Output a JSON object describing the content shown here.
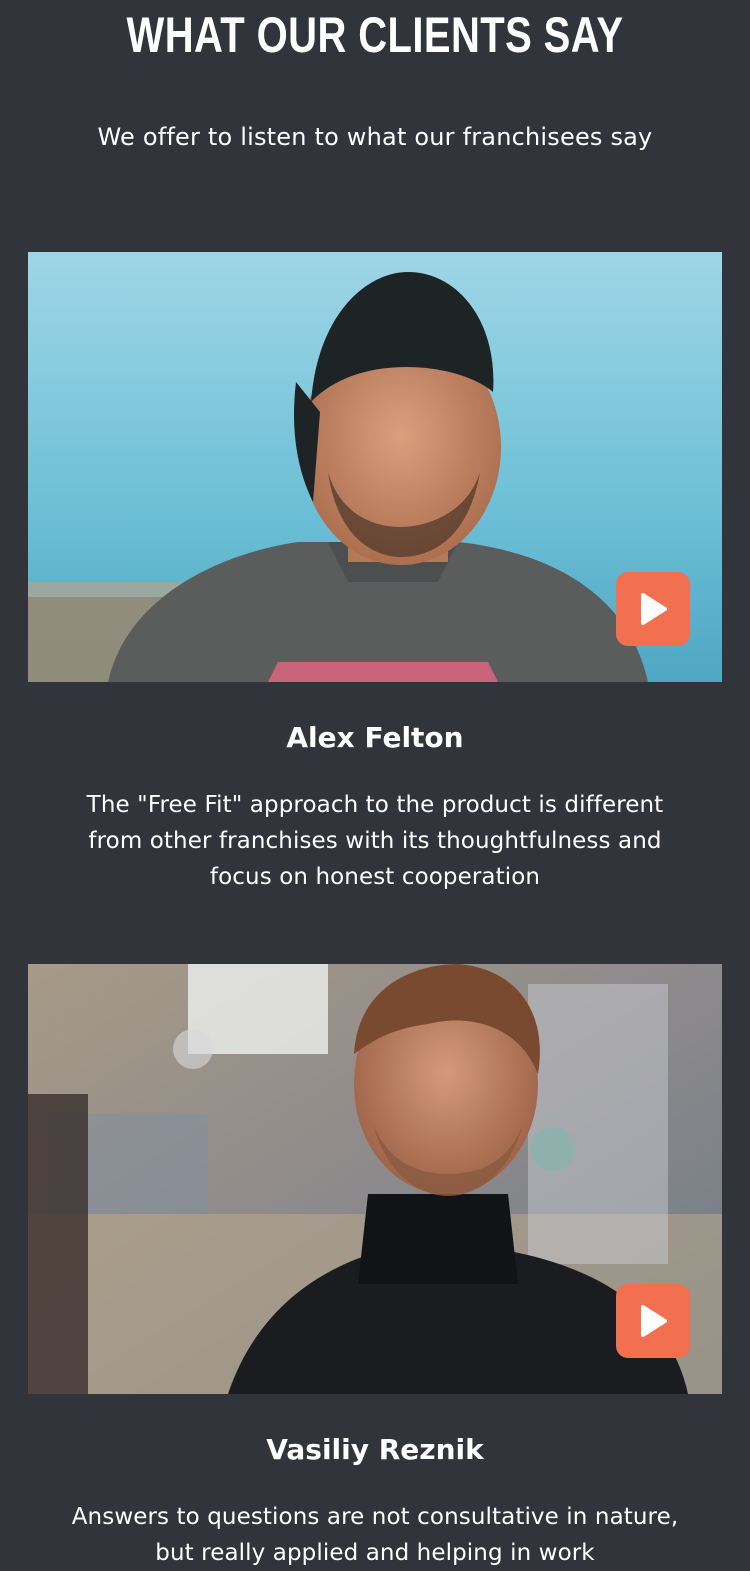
{
  "section": {
    "title": "WHAT OUR CLIENTS SAY",
    "subtitle": "We offer to listen to what our franchisees say"
  },
  "testimonials": [
    {
      "name": "Alex Felton",
      "quote": "The \"Free Fit\" approach to the product is different from other franchises with its thoughtfulness and focus on honest cooperation",
      "play_icon": "play-icon"
    },
    {
      "name": "Vasiliy Reznik",
      "quote": "Answers to questions are not consultative in nature, but really applied and helping in work",
      "play_icon": "play-icon"
    }
  ],
  "colors": {
    "background": "#31343b",
    "accent": "#f26f4f",
    "text": "#ffffff"
  }
}
